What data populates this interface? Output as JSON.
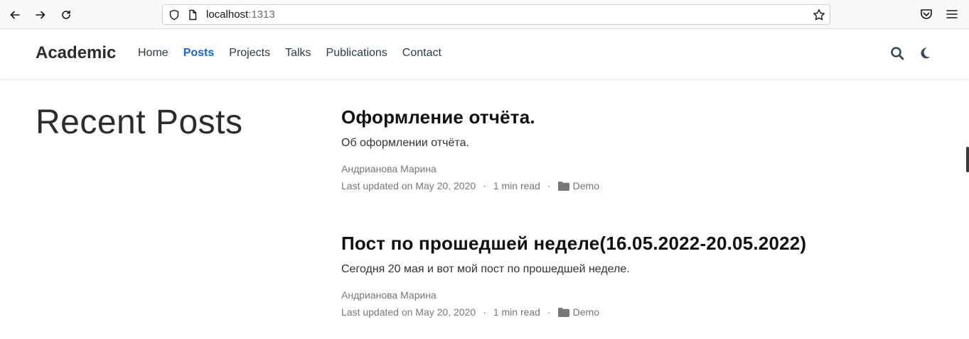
{
  "browser": {
    "url_host": "localhost",
    "url_port": ":1313"
  },
  "header": {
    "brand": "Academic",
    "menu": [
      {
        "label": "Home",
        "active": false
      },
      {
        "label": "Posts",
        "active": true
      },
      {
        "label": "Projects",
        "active": false
      },
      {
        "label": "Talks",
        "active": false
      },
      {
        "label": "Publications",
        "active": false
      },
      {
        "label": "Contact",
        "active": false
      }
    ]
  },
  "main": {
    "section_title": "Recent Posts",
    "posts": [
      {
        "title": "Оформление отчёта.",
        "summary": "Об оформлении отчёта.",
        "author": "Андрианова Марина",
        "updated": "Last updated on May 20, 2020",
        "read_time": "1 min read",
        "category": "Demo"
      },
      {
        "title": "Пост по прошедшей неделе(16.05.2022-20.05.2022)",
        "summary": "Сегодня 20 мая и вот мой пост по прошедшей неделе.",
        "author": "Андрианова Марина",
        "updated": "Last updated on May 20, 2020",
        "read_time": "1 min read",
        "category": "Demo"
      }
    ]
  },
  "colors": {
    "accent": "#1565d8",
    "text": "#2c2c2c",
    "meta": "#777777"
  }
}
